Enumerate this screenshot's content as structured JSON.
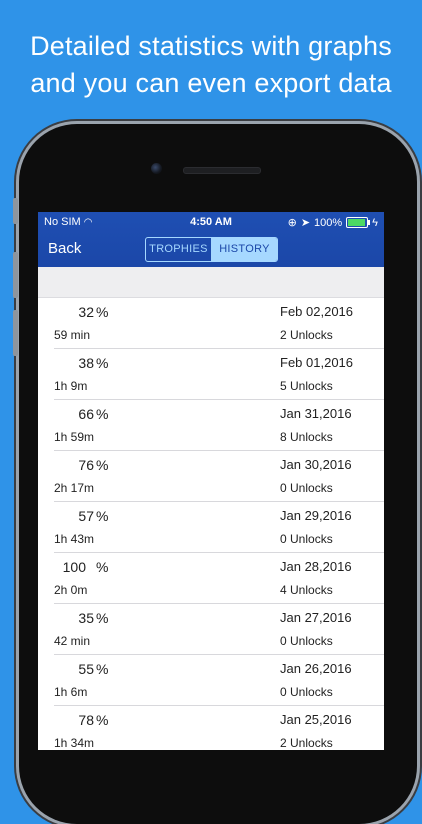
{
  "headline": {
    "line1": "Detailed statistics with graphs",
    "line2": "and you can even export data"
  },
  "status_bar": {
    "carrier": "No SIM",
    "time": "4:50 AM",
    "battery": "100%"
  },
  "nav": {
    "back_label": "Back",
    "tabs": [
      {
        "label": "TROPHIES",
        "selected": false
      },
      {
        "label": "HISTORY",
        "selected": true
      }
    ]
  },
  "history": {
    "percent_symbol": "%",
    "rows": [
      {
        "percent": "32",
        "duration": "59 min",
        "date": "Feb 02,2016",
        "unlocks": "2 Unlocks"
      },
      {
        "percent": "38",
        "duration": "1h 9m",
        "date": "Feb 01,2016",
        "unlocks": "5 Unlocks"
      },
      {
        "percent": "66",
        "duration": "1h 59m",
        "date": "Jan 31,2016",
        "unlocks": "8 Unlocks"
      },
      {
        "percent": "76",
        "duration": "2h 17m",
        "date": "Jan 30,2016",
        "unlocks": "0 Unlocks"
      },
      {
        "percent": "57",
        "duration": "1h 43m",
        "date": "Jan 29,2016",
        "unlocks": "0 Unlocks"
      },
      {
        "percent": "100",
        "duration": "2h 0m",
        "date": "Jan 28,2016",
        "unlocks": "4 Unlocks"
      },
      {
        "percent": "35",
        "duration": "42 min",
        "date": "Jan 27,2016",
        "unlocks": "0 Unlocks"
      },
      {
        "percent": "55",
        "duration": "1h 6m",
        "date": "Jan 26,2016",
        "unlocks": "0 Unlocks"
      },
      {
        "percent": "78",
        "duration": "1h 34m",
        "date": "Jan 25,2016",
        "unlocks": "2 Unlocks"
      }
    ]
  },
  "colors": {
    "background": "#2f93e8",
    "navbar": "#1b47a8",
    "segment_accent": "#a6d8ff"
  }
}
